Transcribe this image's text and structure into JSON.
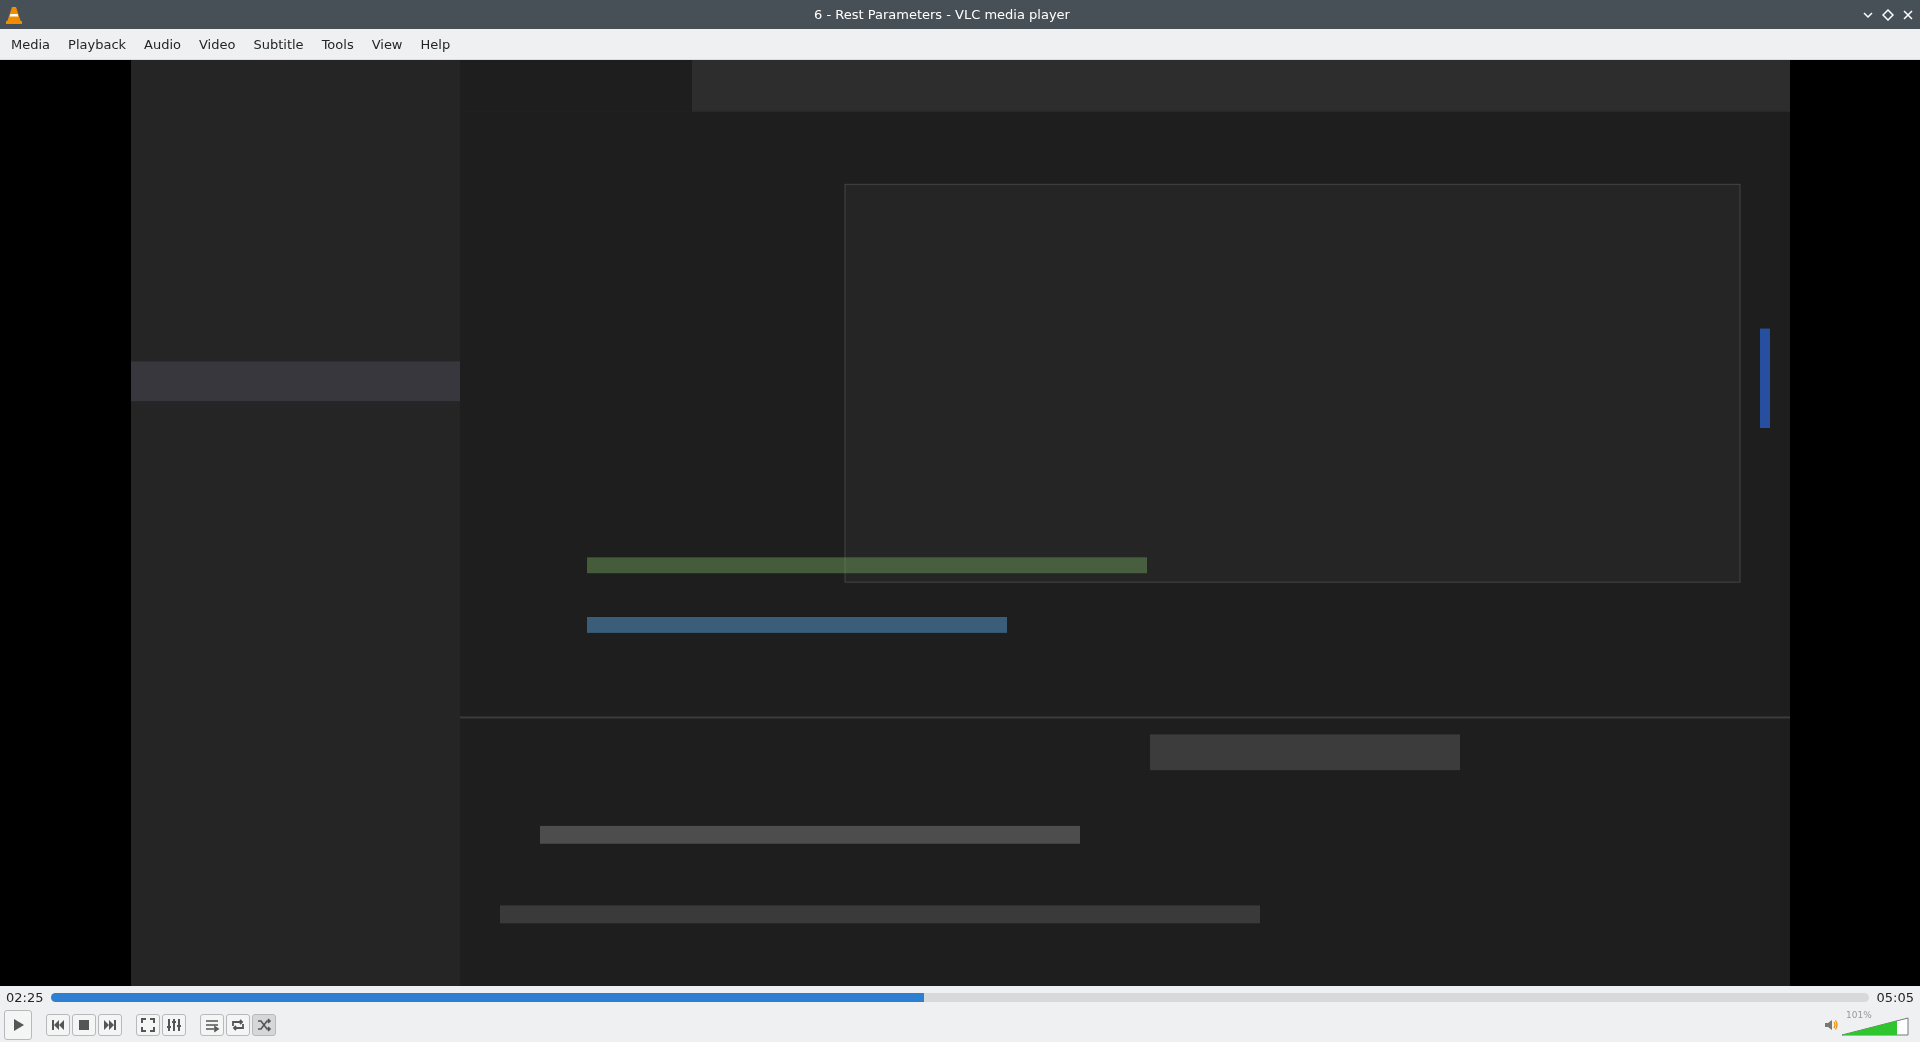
{
  "window": {
    "title": "6 - Rest Parameters - VLC media player"
  },
  "menu": [
    "Media",
    "Playback",
    "Audio",
    "Video",
    "Subtitle",
    "Tools",
    "View",
    "Help"
  ],
  "video": {
    "kind": "picture"
  },
  "seek": {
    "elapsed": "02:25",
    "total": "05:05",
    "level": 0.48
  },
  "controls": [
    {
      "kind": "play",
      "on": false
    },
    {
      "kind": "prev",
      "on": false
    },
    {
      "kind": "stop",
      "on": false
    },
    {
      "kind": "next",
      "on": false
    },
    {
      "kind": "fullscreen",
      "on": false
    },
    {
      "kind": "settings",
      "on": false
    },
    {
      "kind": "playlist",
      "on": false
    },
    {
      "kind": "loop",
      "on": false
    },
    {
      "kind": "shuffle",
      "on": true
    }
  ],
  "volume": {
    "reading": "101%"
  }
}
